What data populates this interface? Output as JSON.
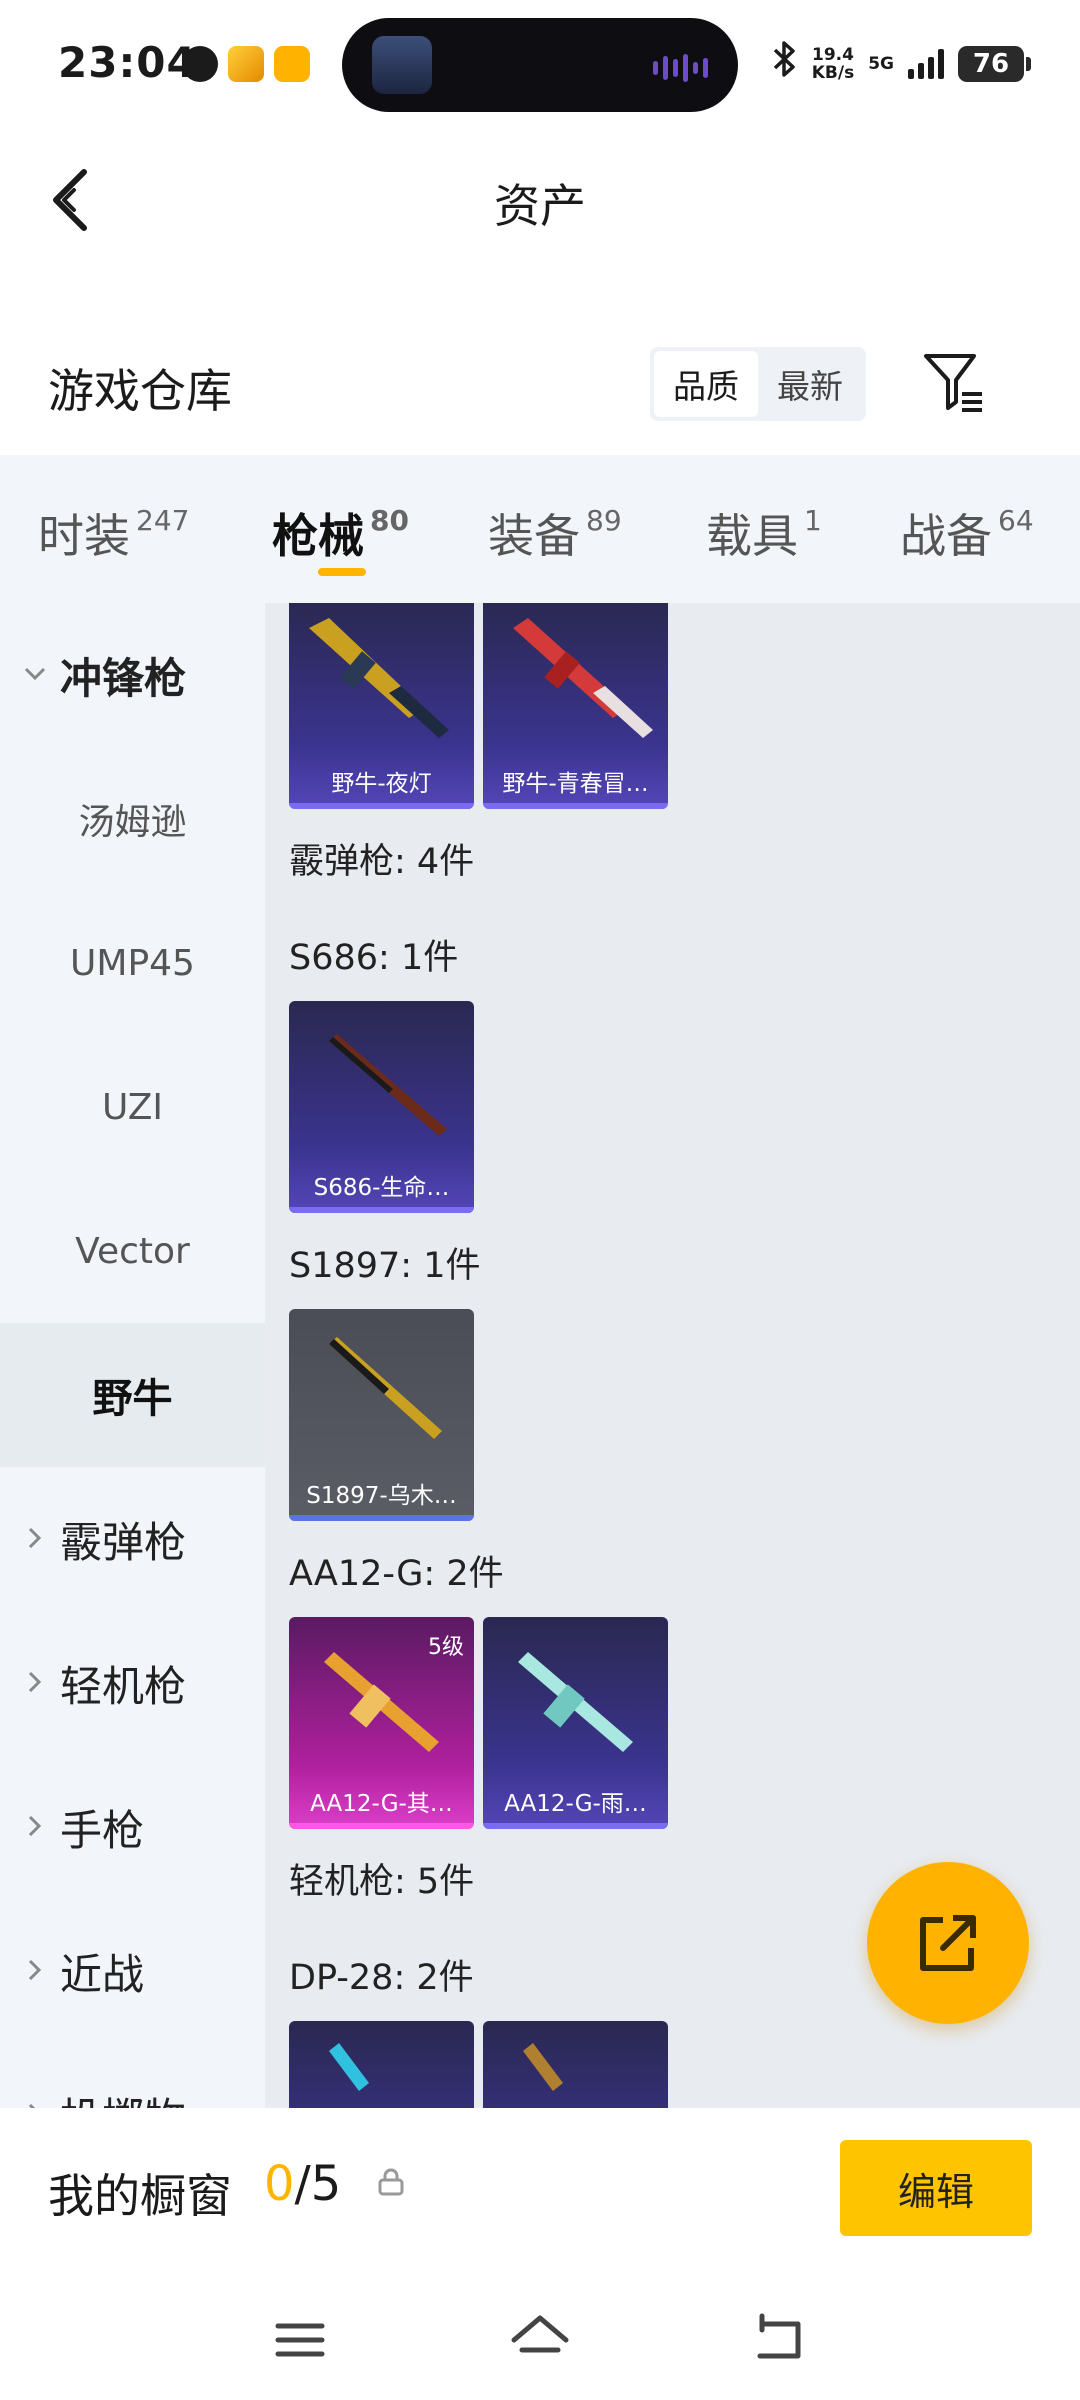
{
  "status_bar": {
    "time": "23:04",
    "net_speed_value": "19.4",
    "net_speed_unit": "KB/s",
    "network_type": "5G",
    "battery": "76"
  },
  "header": {
    "title": "资产"
  },
  "warehouse": {
    "title": "游戏仓库",
    "sort_options": [
      "品质",
      "最新"
    ],
    "sort_selected": "品质"
  },
  "tabs": [
    {
      "label": "时装",
      "count": "247"
    },
    {
      "label": "枪械",
      "count": "80"
    },
    {
      "label": "装备",
      "count": "89"
    },
    {
      "label": "载具",
      "count": "1"
    },
    {
      "label": "战备",
      "count": "64"
    }
  ],
  "sidebar": {
    "items": [
      {
        "label": "冲锋枪",
        "kind": "group",
        "expanded": true
      },
      {
        "label": "汤姆逊",
        "kind": "sub"
      },
      {
        "label": "UMP45",
        "kind": "sub"
      },
      {
        "label": "UZI",
        "kind": "sub"
      },
      {
        "label": "Vector",
        "kind": "sub"
      },
      {
        "label": "野牛",
        "kind": "sub",
        "selected": true
      },
      {
        "label": "霰弹枪",
        "kind": "group"
      },
      {
        "label": "轻机枪",
        "kind": "group"
      },
      {
        "label": "手枪",
        "kind": "group"
      },
      {
        "label": "近战",
        "kind": "group"
      },
      {
        "label": "投掷物",
        "kind": "group"
      }
    ]
  },
  "main": {
    "cards_top": [
      {
        "name": "野牛-夜灯",
        "tier": "purple"
      },
      {
        "name": "野牛-青春冒…",
        "tier": "purple"
      }
    ],
    "label_shotgun": "霰弹枪: 4件",
    "label_s686": "S686: 1件",
    "cards_s686": [
      {
        "name": "S686-生命…",
        "tier": "purple"
      }
    ],
    "label_s1897": "S1897: 1件",
    "cards_s1897": [
      {
        "name": "S1897-乌木…",
        "tier": "gray"
      }
    ],
    "label_aa12": "AA12-G: 2件",
    "cards_aa12": [
      {
        "name": "AA12-G-其…",
        "tier": "pink",
        "level": "5级"
      },
      {
        "name": "AA12-G-雨…",
        "tier": "purple"
      }
    ],
    "label_lmg": "轻机枪: 5件",
    "label_dp28": "DP-28: 2件"
  },
  "showcase": {
    "title": "我的橱窗",
    "current": "0",
    "total": "/5",
    "edit_label": "编辑"
  },
  "colors": {
    "accent": "#ffb400",
    "tab_bg": "#f2f6fa",
    "list_bg": "#e8ecf1",
    "purple_tier": "#5546b8",
    "pink_tier": "#dc3fc9",
    "gray_tier": "#5a5d66"
  }
}
